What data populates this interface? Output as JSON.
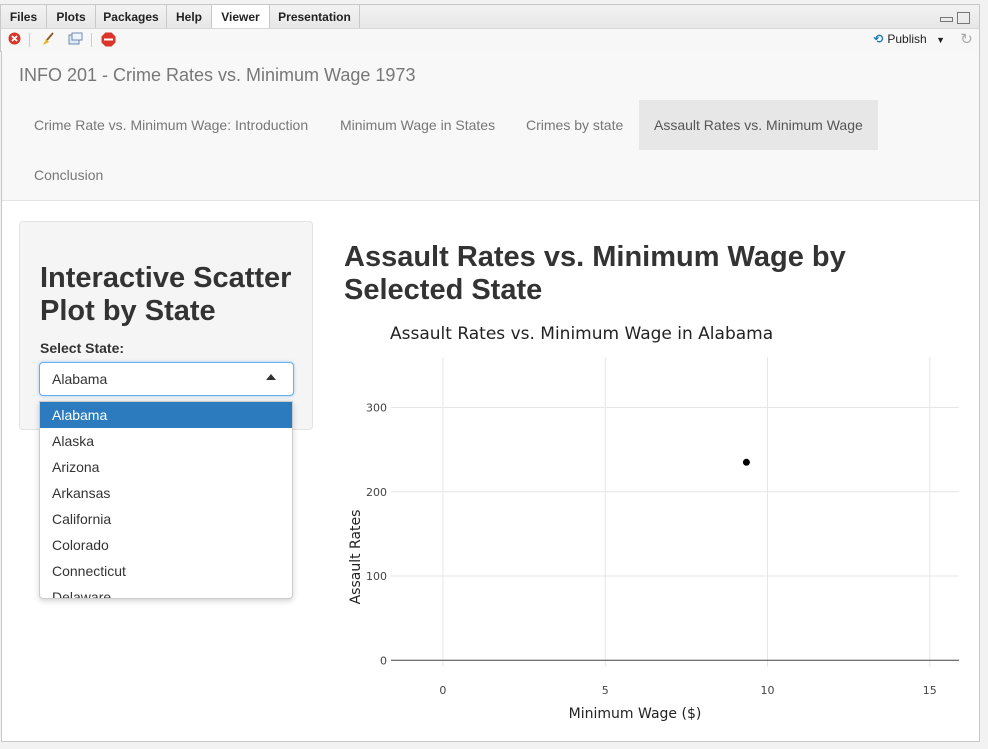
{
  "pane": {
    "tabs": [
      "Files",
      "Plots",
      "Packages",
      "Help",
      "Viewer",
      "Presentation"
    ],
    "active_tab": "Viewer",
    "publish_label": "Publish"
  },
  "app": {
    "brand": "INFO 201 - Crime Rates vs. Minimum Wage 1973",
    "nav": [
      "Crime Rate vs. Minimum Wage: Introduction",
      "Minimum Wage in States",
      "Crimes by state",
      "Assault Rates vs. Minimum Wage",
      "Conclusion"
    ],
    "active_nav": "Assault Rates vs. Minimum Wage"
  },
  "sidebar": {
    "title": "Interactive Scatter Plot by State",
    "select_label": "Select State:",
    "selected": "Alabama",
    "options": [
      "Alabama",
      "Alaska",
      "Arizona",
      "Arkansas",
      "California",
      "Colorado",
      "Connecticut",
      "Delaware"
    ]
  },
  "main": {
    "title": "Assault Rates vs. Minimum Wage by Selected State"
  },
  "chart_data": {
    "type": "scatter",
    "title": "Assault Rates vs. Minimum Wage in Alabama",
    "xlabel": "Minimum Wage ($)",
    "ylabel": "Assault Rates",
    "xlim": [
      -1.6,
      15.9
    ],
    "ylim": [
      -8,
      360
    ],
    "xticks": [
      0,
      5,
      10,
      15
    ],
    "yticks": [
      0,
      100,
      200,
      300
    ],
    "grid": true,
    "points": [
      {
        "x": 9.35,
        "y": 235
      }
    ],
    "point_color": "#000000"
  }
}
